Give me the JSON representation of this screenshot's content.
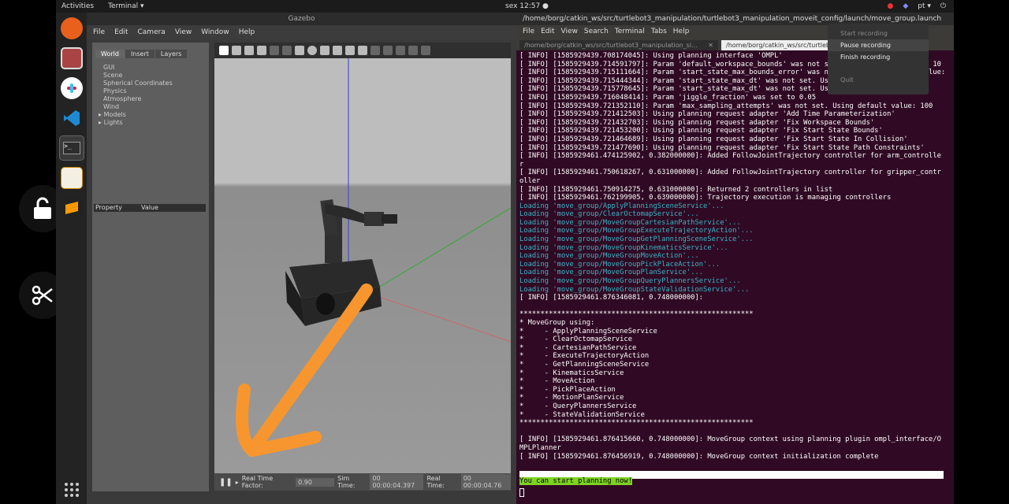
{
  "topbar": {
    "activities": "Activities",
    "app_name": "Terminal ▾",
    "clock": "sex 12:57 ●",
    "lang": "pt ▾"
  },
  "gazebo": {
    "title": "Gazebo",
    "menu": [
      "File",
      "Edit",
      "Camera",
      "View",
      "Window",
      "Help"
    ],
    "tabs": [
      "World",
      "Insert",
      "Layers"
    ],
    "tree": [
      "GUI",
      "Scene",
      "Spherical Coordinates",
      "Physics",
      "Atmosphere",
      "Wind",
      "Models",
      "Lights"
    ],
    "props_header": {
      "property": "Property",
      "value": "Value"
    },
    "status": {
      "rtf_label": "Real Time Factor:",
      "rtf_value": "0.90",
      "sim_label": "Sim Time:",
      "sim_value": "00 00:00:04.397",
      "real_label": "Real Time:",
      "real_value": "00 00:00:04.76"
    }
  },
  "terminal": {
    "title": "/home/borg/catkin_ws/src/turtlebot3_manipulation/turtlebot3_manipulation_moveit_config/launch/move_group.launch",
    "menu": [
      "File",
      "Edit",
      "View",
      "Search",
      "Terminal",
      "Tabs",
      "Help"
    ],
    "tabs": [
      {
        "label": "/home/borg/catkin_ws/src/turtlebot3_manipulation_si...",
        "active": false
      },
      {
        "label": "/home/borg/catkin_ws/src/turtlebot3_manipulation/turtlebot3_ma...",
        "active": true
      }
    ],
    "lines": [
      {
        "text": "[ INFO] [1585929439.708174045]: Using planning interface 'OMPL'",
        "cyan": false
      },
      {
        "text": "[ INFO] [1585929439.714591797]: Param 'default_workspace_bounds' was not set. Using default value: 10",
        "cyan": false
      },
      {
        "text": "[ INFO] [1585929439.715111664]: Param 'start_state_max_bounds_error' was not set. Using default value: 0.1",
        "cyan": false
      },
      {
        "text": "[ INFO] [1585929439.715444344]: Param 'start_state_max_dt' was not set. Using default value: 0.5",
        "cyan": false
      },
      {
        "text": "[ INFO] [1585929439.715778645]: Param 'start_state_max_dt' was not set. Using default value: 0.5",
        "cyan": false
      },
      {
        "text": "[ INFO] [1585929439.716048414]: Param 'jiggle_fraction' was set to 0.05",
        "cyan": false
      },
      {
        "text": "[ INFO] [1585929439.721352110]: Param 'max_sampling_attempts' was not set. Using default value: 100",
        "cyan": false
      },
      {
        "text": "[ INFO] [1585929439.721412503]: Using planning request adapter 'Add Time Parameterization'",
        "cyan": false
      },
      {
        "text": "[ INFO] [1585929439.721432703]: Using planning request adapter 'Fix Workspace Bounds'",
        "cyan": false
      },
      {
        "text": "[ INFO] [1585929439.721453200]: Using planning request adapter 'Fix Start State Bounds'",
        "cyan": false
      },
      {
        "text": "[ INFO] [1585929439.721464689]: Using planning request adapter 'Fix Start State In Collision'",
        "cyan": false
      },
      {
        "text": "[ INFO] [1585929439.721477690]: Using planning request adapter 'Fix Start State Path Constraints'",
        "cyan": false
      },
      {
        "text": "[ INFO] [1585929461.474125902, 0.382000000]: Added FollowJointTrajectory controller for arm_controlle",
        "cyan": false
      },
      {
        "text": "r",
        "cyan": false
      },
      {
        "text": "[ INFO] [1585929461.750618267, 0.631000000]: Added FollowJointTrajectory controller for gripper_contr",
        "cyan": false
      },
      {
        "text": "oller",
        "cyan": false
      },
      {
        "text": "[ INFO] [1585929461.750914275, 0.631000000]: Returned 2 controllers in list",
        "cyan": false
      },
      {
        "text": "[ INFO] [1585929461.762199905, 0.639000000]: Trajectory execution is managing controllers",
        "cyan": false
      },
      {
        "text": "Loading 'move_group/ApplyPlanningSceneService'...",
        "cyan": true
      },
      {
        "text": "Loading 'move_group/ClearOctomapService'...",
        "cyan": true
      },
      {
        "text": "Loading 'move_group/MoveGroupCartesianPathService'...",
        "cyan": true
      },
      {
        "text": "Loading 'move_group/MoveGroupExecuteTrajectoryAction'...",
        "cyan": true
      },
      {
        "text": "Loading 'move_group/MoveGroupGetPlanningSceneService'...",
        "cyan": true
      },
      {
        "text": "Loading 'move_group/MoveGroupKinematicsService'...",
        "cyan": true
      },
      {
        "text": "Loading 'move_group/MoveGroupMoveAction'...",
        "cyan": true
      },
      {
        "text": "Loading 'move_group/MoveGroupPickPlaceAction'...",
        "cyan": true
      },
      {
        "text": "Loading 'move_group/MoveGroupPlanService'...",
        "cyan": true
      },
      {
        "text": "Loading 'move_group/MoveGroupQueryPlannersService'...",
        "cyan": true
      },
      {
        "text": "Loading 'move_group/MoveGroupStateValidationService'...",
        "cyan": true
      },
      {
        "text": "[ INFO] [1585929461.876346081, 0.748000000]:",
        "cyan": false
      },
      {
        "text": "",
        "cyan": false
      },
      {
        "text": "********************************************************",
        "cyan": false
      },
      {
        "text": "* MoveGroup using:",
        "cyan": false
      },
      {
        "text": "*     - ApplyPlanningSceneService",
        "cyan": false
      },
      {
        "text": "*     - ClearOctomapService",
        "cyan": false
      },
      {
        "text": "*     - CartesianPathService",
        "cyan": false
      },
      {
        "text": "*     - ExecuteTrajectoryAction",
        "cyan": false
      },
      {
        "text": "*     - GetPlanningSceneService",
        "cyan": false
      },
      {
        "text": "*     - KinematicsService",
        "cyan": false
      },
      {
        "text": "*     - MoveAction",
        "cyan": false
      },
      {
        "text": "*     - PickPlaceAction",
        "cyan": false
      },
      {
        "text": "*     - MotionPlanService",
        "cyan": false
      },
      {
        "text": "*     - QueryPlannersService",
        "cyan": false
      },
      {
        "text": "*     - StateValidationService",
        "cyan": false
      },
      {
        "text": "********************************************************",
        "cyan": false
      },
      {
        "text": "",
        "cyan": false
      },
      {
        "text": "[ INFO] [1585929461.876415660, 0.748000000]: MoveGroup context using planning plugin ompl_interface/O",
        "cyan": false
      },
      {
        "text": "MPLPlanner",
        "cyan": false
      },
      {
        "text": "[ INFO] [1585929461.876456919, 0.748000000]: MoveGroup context initialization complete",
        "cyan": false
      }
    ],
    "highlight": "You can start planning now!"
  },
  "recording_menu": {
    "items": [
      {
        "label": "Start recording",
        "state": "disabled"
      },
      {
        "label": "Pause recording",
        "state": "hover"
      },
      {
        "label": "Finish recording",
        "state": "normal"
      },
      {
        "label": "Quit",
        "state": "disabled"
      }
    ]
  }
}
